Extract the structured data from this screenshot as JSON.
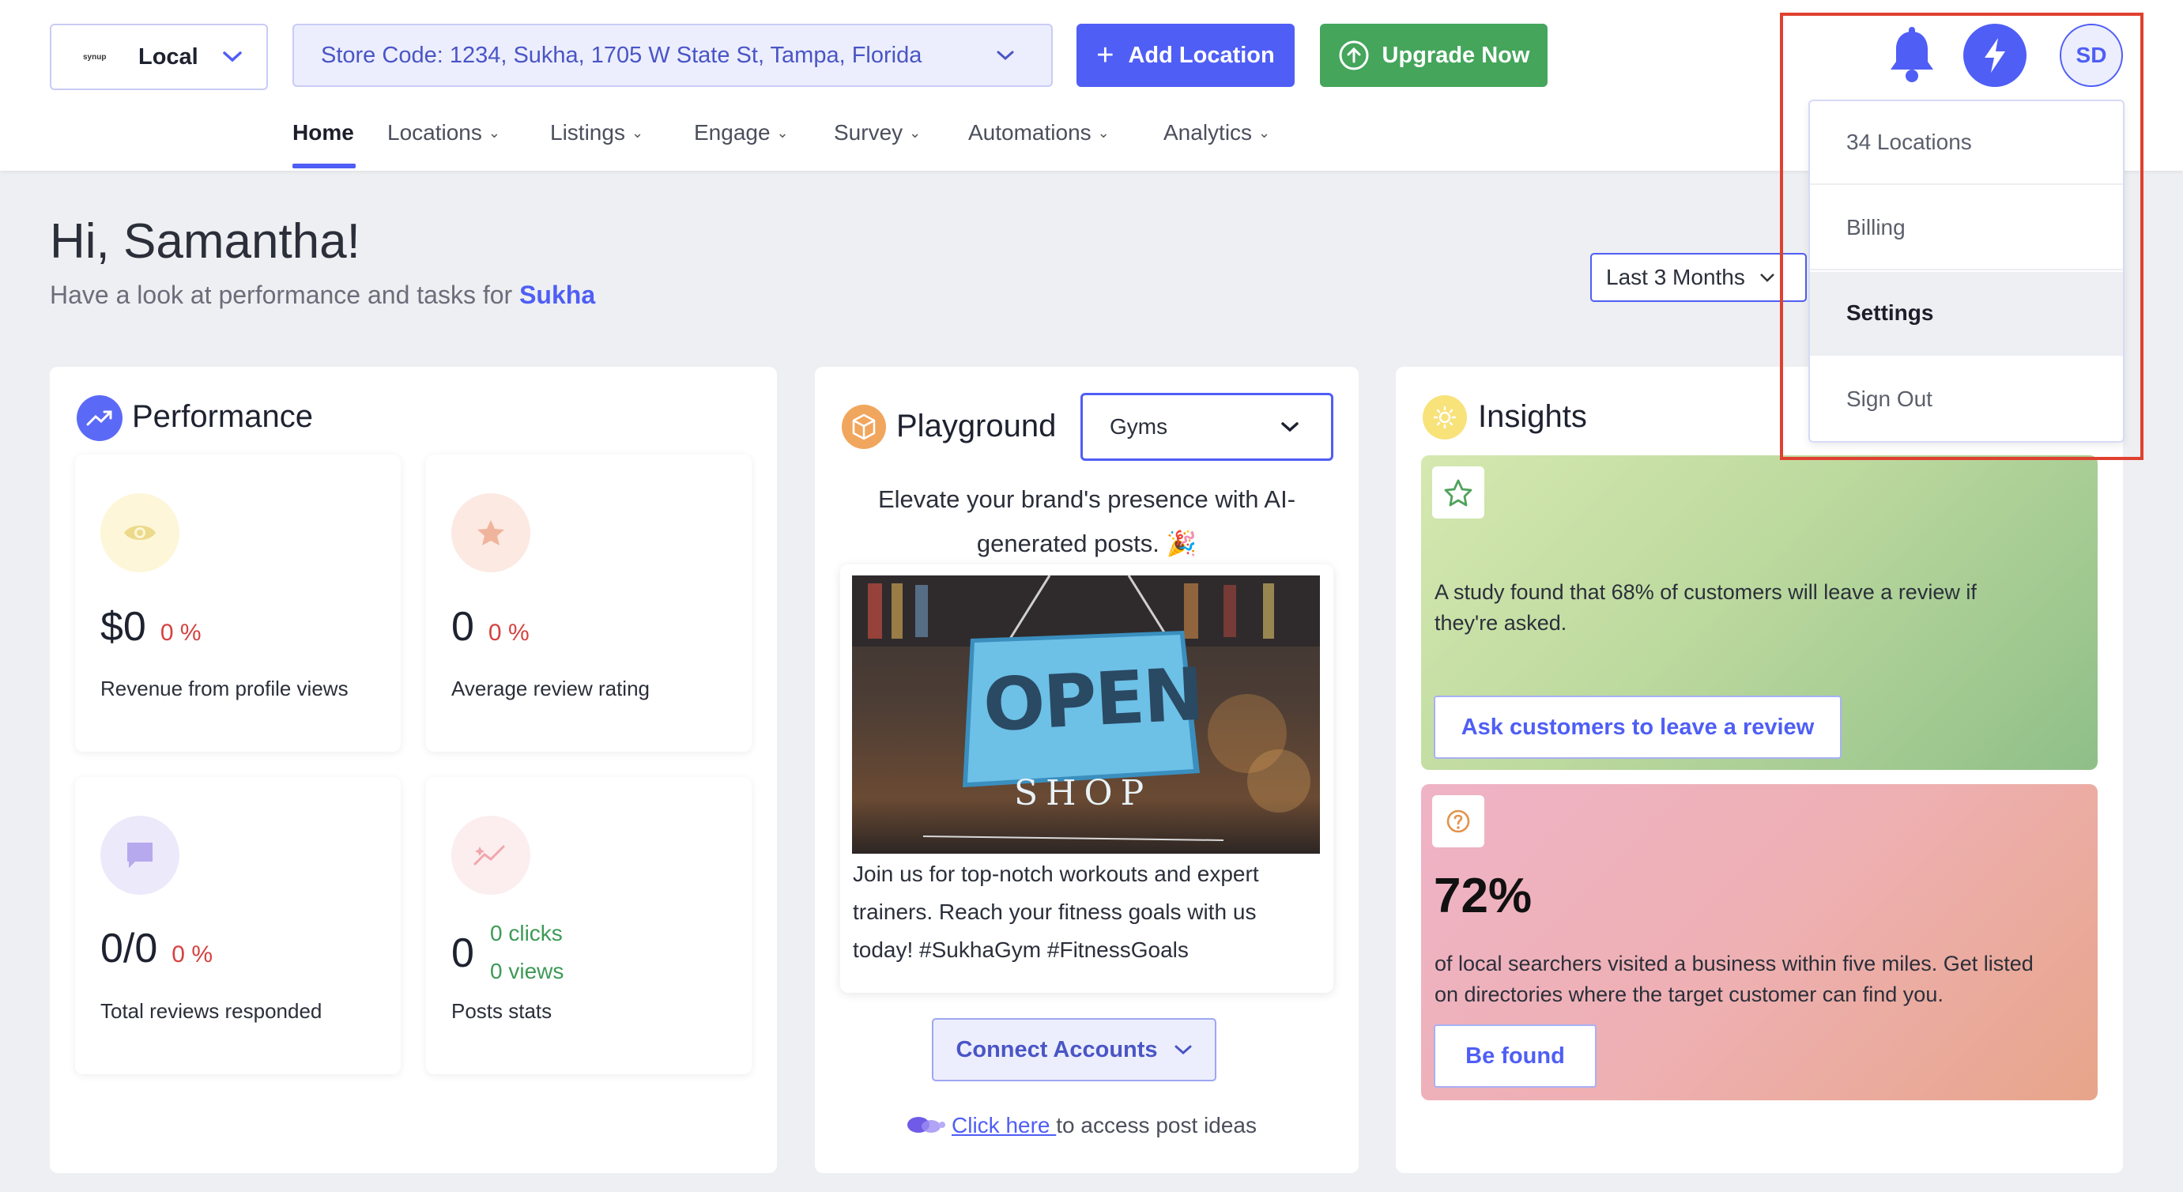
{
  "header": {
    "brand_label": "Local",
    "logo_text": "synup",
    "store_selector": "Store Code: 1234, Sukha, 1705 W State St, Tampa, Florida",
    "add_location": "Add Location",
    "upgrade": "Upgrade Now",
    "avatar_initials": "SD"
  },
  "nav": {
    "items": [
      {
        "label": "Home",
        "active": true
      },
      {
        "label": "Locations"
      },
      {
        "label": "Listings"
      },
      {
        "label": "Engage"
      },
      {
        "label": "Survey"
      },
      {
        "label": "Automations"
      },
      {
        "label": "Analytics"
      }
    ]
  },
  "greeting": {
    "title": "Hi, Samantha!",
    "subtitle_prefix": "Have a look at performance and tasks for",
    "business": "Sukha",
    "date_range": "Last 3 Months"
  },
  "performance": {
    "title": "Performance",
    "metrics": [
      {
        "value": "$0",
        "change": "0 %",
        "label": "Revenue from profile views"
      },
      {
        "value": "0",
        "change": "0 %",
        "label": "Average review rating"
      },
      {
        "value": "0/0",
        "change": "0 %",
        "label": "Total reviews responded"
      },
      {
        "value": "0",
        "clicks": "0 clicks",
        "views": "0 views",
        "label": "Posts stats"
      }
    ]
  },
  "playground": {
    "title": "Playground",
    "category": "Gyms",
    "intro_line1": "Elevate your brand's presence with AI-",
    "intro_line2": "generated posts. 🎉",
    "sign_word1": "OPEN",
    "sign_word2": "SHOP",
    "post_line1": "Join us for top-notch workouts and expert",
    "post_line2": "trainers. Reach your fitness goals with us",
    "post_line3": "today! #SukhaGym #FitnessGoals",
    "connect": "Connect Accounts",
    "click_here": "Click here ",
    "access_text": "to access post ideas"
  },
  "insights": {
    "title": "Insights",
    "card1_line1": "A study found that 68% of customers will leave a review if",
    "card1_line2": "they're asked.",
    "card1_button": "Ask customers to leave a review",
    "card2_stat": "72%",
    "card2_line1": "of local searchers visited a business within five miles. Get listed",
    "card2_line2": "on directories where the target customer can find you.",
    "card2_button": "Be found"
  },
  "account_menu": {
    "items": [
      {
        "label": "34 Locations"
      },
      {
        "label": "Billing"
      },
      {
        "label": "Settings",
        "active": true
      },
      {
        "label": "Sign Out"
      }
    ]
  },
  "colors": {
    "accent": "#4f5ef5",
    "green": "#44a55b",
    "negative": "#d54240",
    "highlight_box": "#e0402f"
  }
}
